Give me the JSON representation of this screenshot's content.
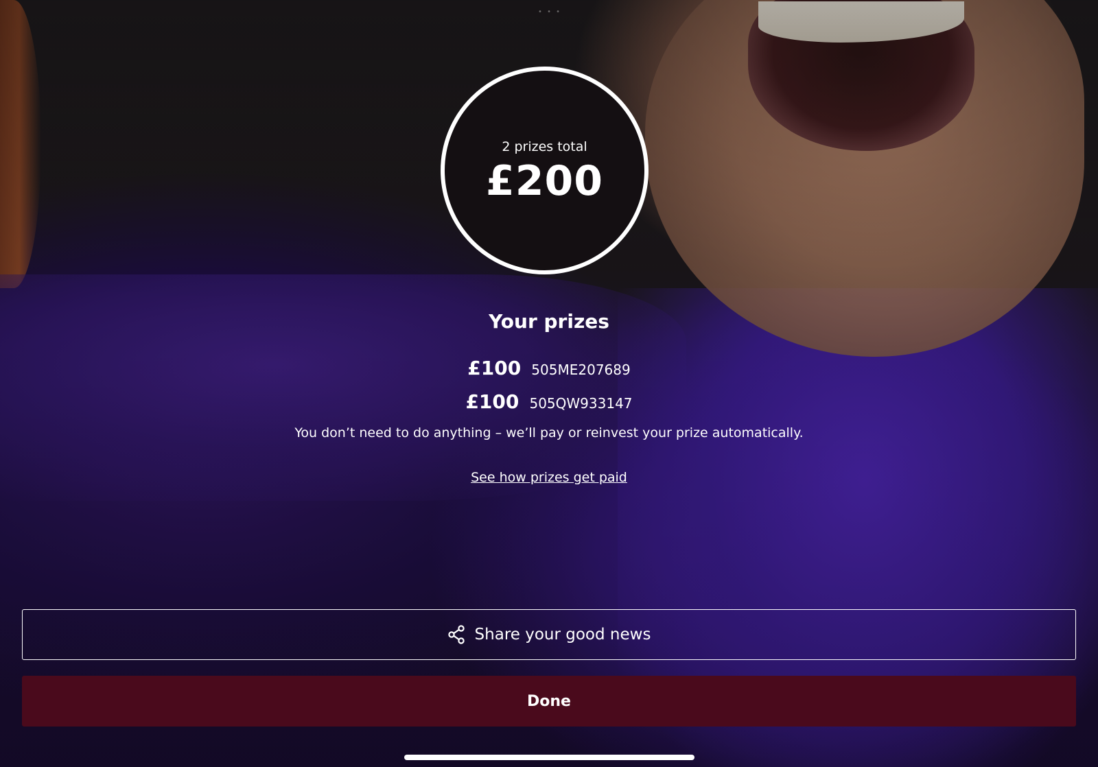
{
  "summary": {
    "count_text": "2 prizes total",
    "total_amount": "£200"
  },
  "prizes": {
    "heading": "Your prizes",
    "items": [
      {
        "amount": "£100",
        "code": "505ME207689"
      },
      {
        "amount": "£100",
        "code": "505QW933147"
      }
    ],
    "info": "You don’t need to do anything – we’ll pay or reinvest your prize automatically.",
    "link_label": "See how prizes get paid"
  },
  "actions": {
    "share_label": "Share your good news",
    "share_icon": "share-icon",
    "done_label": "Done"
  },
  "colors": {
    "done_button": "#4a0a1c",
    "text": "#ffffff"
  }
}
